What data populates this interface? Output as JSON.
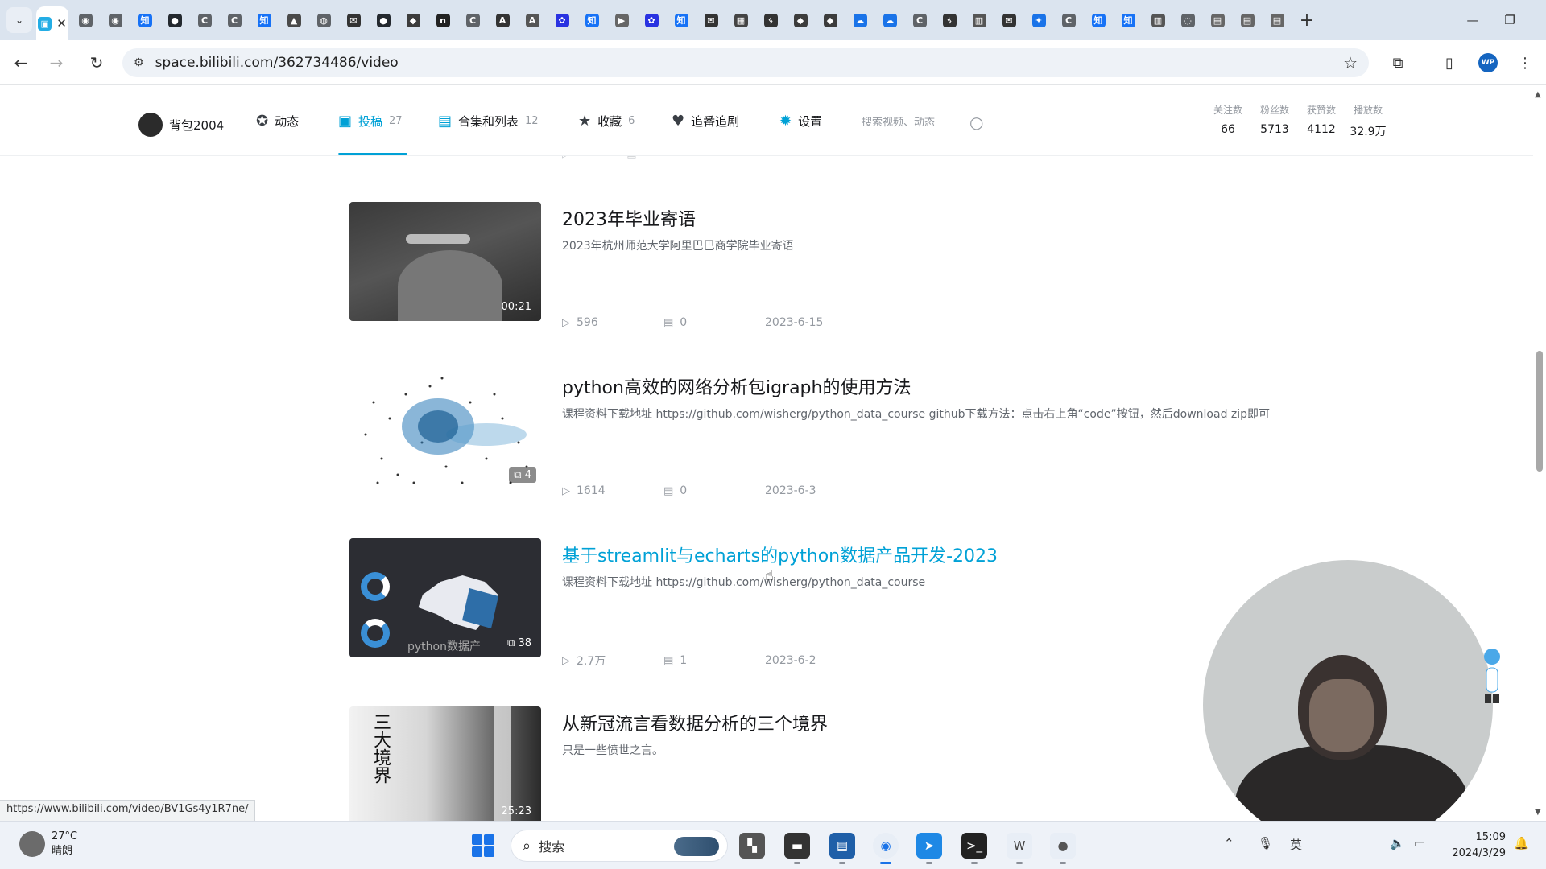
{
  "browser": {
    "tabs": [
      {
        "icon": "bilibili-tv-icon",
        "color": "#23ade5",
        "glyph": "▣"
      },
      {
        "icon": "chrome-extension-icon",
        "color": "#5f6368",
        "glyph": "◉"
      },
      {
        "icon": "chrome-extension-icon",
        "color": "#5f6368",
        "glyph": "◉"
      },
      {
        "icon": "zhihu-icon",
        "color": "#1772f6",
        "glyph": "知"
      },
      {
        "icon": "github-icon",
        "color": "#24292f",
        "glyph": "●"
      },
      {
        "icon": "c-icon",
        "color": "#5f6368",
        "glyph": "C"
      },
      {
        "icon": "c-icon",
        "color": "#5f6368",
        "glyph": "C"
      },
      {
        "icon": "zhihu-icon",
        "color": "#1772f6",
        "glyph": "知"
      },
      {
        "icon": "site-icon",
        "color": "#4a4a4a",
        "glyph": "▲"
      },
      {
        "icon": "globe-icon",
        "color": "#5f6368",
        "glyph": "◍"
      },
      {
        "icon": "mail-icon",
        "color": "#333333",
        "glyph": "✉"
      },
      {
        "icon": "github-icon",
        "color": "#24292f",
        "glyph": "●"
      },
      {
        "icon": "site-icon",
        "color": "#3c3c3c",
        "glyph": "◆"
      },
      {
        "icon": "n-icon",
        "color": "#222222",
        "glyph": "n"
      },
      {
        "icon": "c-icon",
        "color": "#5f6368",
        "glyph": "C"
      },
      {
        "icon": "a-icon",
        "color": "#333333",
        "glyph": "A"
      },
      {
        "icon": "a-icon",
        "color": "#555555",
        "glyph": "A"
      },
      {
        "icon": "baidu-icon",
        "color": "#2932e1",
        "glyph": "✿"
      },
      {
        "icon": "zhihu-icon",
        "color": "#1772f6",
        "glyph": "知"
      },
      {
        "icon": "video-icon",
        "color": "#666666",
        "glyph": "▶"
      },
      {
        "icon": "baidu-icon",
        "color": "#2932e1",
        "glyph": "✿"
      },
      {
        "icon": "zhihu-icon",
        "color": "#1772f6",
        "glyph": "知"
      },
      {
        "icon": "mail-icon",
        "color": "#333333",
        "glyph": "✉"
      },
      {
        "icon": "site-icon",
        "color": "#444444",
        "glyph": "▦"
      },
      {
        "icon": "site-icon",
        "color": "#333333",
        "glyph": "ᛃ"
      },
      {
        "icon": "site-icon",
        "color": "#3c3c3c",
        "glyph": "◆"
      },
      {
        "icon": "site-icon",
        "color": "#3c3c3c",
        "glyph": "◆"
      },
      {
        "icon": "cloud-icon",
        "color": "#1a73e8",
        "glyph": "☁"
      },
      {
        "icon": "cloud-icon",
        "color": "#1a73e8",
        "glyph": "☁"
      },
      {
        "icon": "c-icon",
        "color": "#5f6368",
        "glyph": "C"
      },
      {
        "icon": "site-icon",
        "color": "#333333",
        "glyph": "ᛃ"
      },
      {
        "icon": "book-icon",
        "color": "#555555",
        "glyph": "▥"
      },
      {
        "icon": "mail-icon",
        "color": "#333333",
        "glyph": "✉"
      },
      {
        "icon": "site-icon",
        "color": "#1a73e8",
        "glyph": "✦"
      },
      {
        "icon": "c-icon",
        "color": "#5f6368",
        "glyph": "C"
      },
      {
        "icon": "zhihu-icon",
        "color": "#1772f6",
        "glyph": "知"
      },
      {
        "icon": "zhihu-icon",
        "color": "#1772f6",
        "glyph": "知"
      },
      {
        "icon": "book-icon",
        "color": "#555555",
        "glyph": "▥"
      },
      {
        "icon": "loading-icon",
        "color": "#5f6368",
        "glyph": "◌"
      },
      {
        "icon": "doc-icon",
        "color": "#666666",
        "glyph": "▤"
      },
      {
        "icon": "doc-icon",
        "color": "#666666",
        "glyph": "▤"
      },
      {
        "icon": "doc-icon",
        "color": "#666666",
        "glyph": "▤"
      }
    ],
    "active_tab_close": "✕",
    "new_tab": "+",
    "address_url": "space.bilibili.com/362734486/video",
    "status_url": "https://www.bilibili.com/video/BV1Gs4y1R7ne/"
  },
  "profile": {
    "username": "背包2004",
    "nav": [
      {
        "label": "动态",
        "count": ""
      },
      {
        "label": "投稿",
        "count": "27"
      },
      {
        "label": "合集和列表",
        "count": "12"
      },
      {
        "label": "收藏",
        "count": "6"
      },
      {
        "label": "追番追剧",
        "count": ""
      },
      {
        "label": "设置",
        "count": ""
      }
    ],
    "search_placeholder": "搜索视频、动态",
    "stats": [
      {
        "label": "关注数",
        "value": "66"
      },
      {
        "label": "粉丝数",
        "value": "5713"
      },
      {
        "label": "获赞数",
        "value": "4112"
      },
      {
        "label": "播放数",
        "value": "32.9万"
      }
    ]
  },
  "videos": [
    {
      "title": "2023年毕业寄语",
      "desc": "2023年杭州师范大学阿里巴巴商学院毕业寄语",
      "duration": "00:21",
      "views": "596",
      "comments": "0",
      "date": "2023-6-15"
    },
    {
      "title": "python高效的网络分析包igraph的使用方法",
      "desc": "课程资料下载地址 https://github.com/wisherg/python_data_course github下载方法：点击右上角“code”按钮，然后download zip即可",
      "badge": "4",
      "views": "1614",
      "comments": "0",
      "date": "2023-6-3"
    },
    {
      "title": "基于streamlit与echarts的python数据产品开发-2023",
      "desc": "课程资料下载地址 https://github.com/wisherg/python_data_course",
      "badge": "38",
      "thumb_caption": "python数据产",
      "views": "2.7万",
      "comments": "1",
      "date": "2023-6-2"
    },
    {
      "title": "从新冠流言看数据分析的三个境界",
      "desc": "只是一些愤世之言。",
      "duration": "25:23",
      "thumb_caption": "三大境界"
    }
  ],
  "taskbar": {
    "weather_temp": "27°C",
    "weather_desc": "晴朗",
    "search_label": "搜索",
    "time": "15:09",
    "date": "2024/3/29"
  },
  "colors": {
    "accent": "#00a1d6",
    "tabstrip": "#dbe4ef"
  }
}
